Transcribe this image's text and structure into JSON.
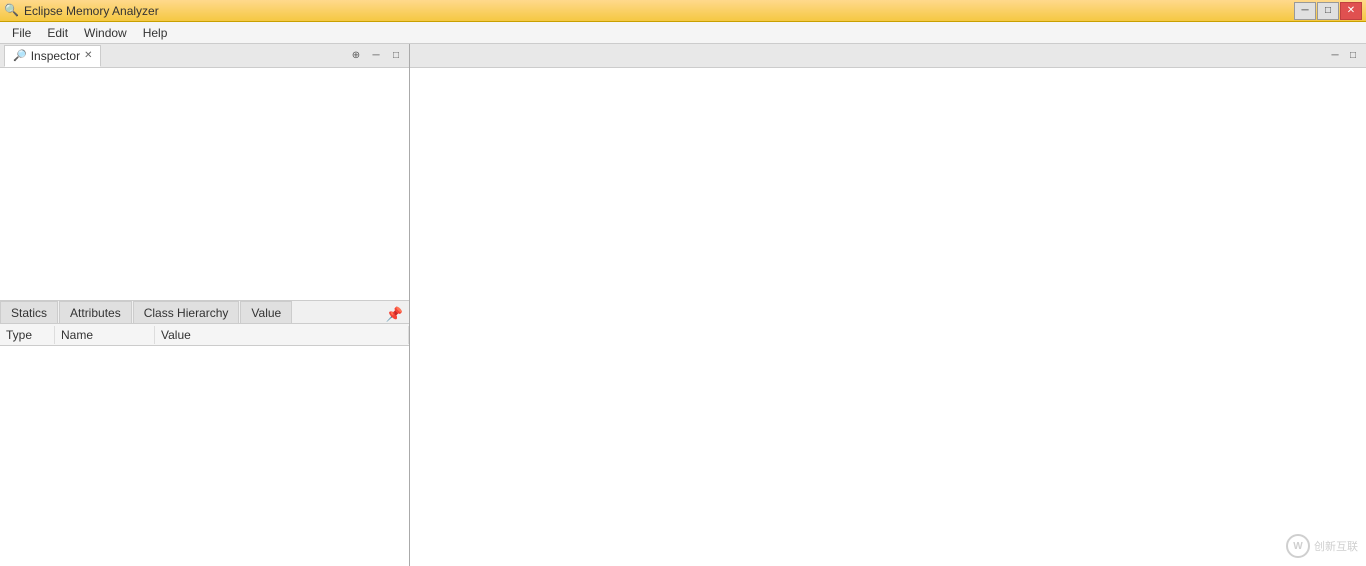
{
  "window": {
    "title": "Eclipse Memory Analyzer",
    "icon": "🔍"
  },
  "titlebar": {
    "minimize_label": "─",
    "restore_label": "□",
    "close_label": "✕"
  },
  "menubar": {
    "items": [
      {
        "label": "File",
        "id": "file"
      },
      {
        "label": "Edit",
        "id": "edit"
      },
      {
        "label": "Window",
        "id": "window"
      },
      {
        "label": "Help",
        "id": "help"
      }
    ]
  },
  "inspector_panel": {
    "tab_label": "Inspector",
    "close_icon": "✕",
    "pin_icon": "⊕",
    "minimize_icon": "─",
    "maximize_icon": "□"
  },
  "bottom_tabs": {
    "tabs": [
      {
        "label": "Statics",
        "id": "statics",
        "active": false
      },
      {
        "label": "Attributes",
        "id": "attributes",
        "active": false
      },
      {
        "label": "Class Hierarchy",
        "id": "class-hierarchy",
        "active": false
      },
      {
        "label": "Value",
        "id": "value",
        "active": false
      }
    ],
    "pin_icon": "📌"
  },
  "table": {
    "columns": [
      {
        "label": "Type",
        "id": "type"
      },
      {
        "label": "Name",
        "id": "name"
      },
      {
        "label": "Value",
        "id": "value"
      }
    ],
    "rows": []
  },
  "right_panel": {
    "minimize_icon": "─",
    "maximize_icon": "□"
  },
  "watermark": {
    "text": "创新互联",
    "symbol": "W"
  }
}
